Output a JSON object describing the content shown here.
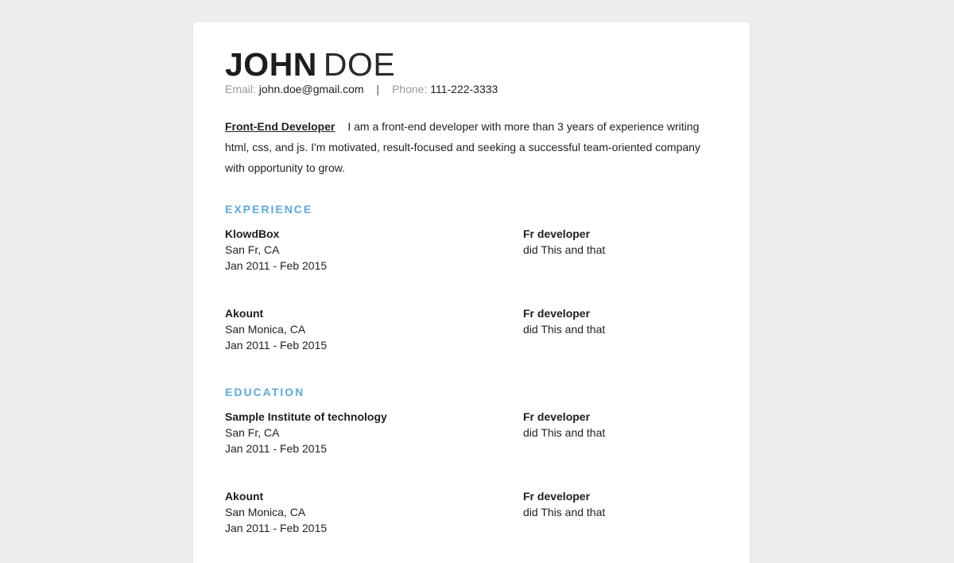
{
  "header": {
    "first_name": "JOHN",
    "last_name": "DOE",
    "email_label": "Email:",
    "email": "john.doe@gmail.com",
    "separator": "|",
    "phone_label": "Phone:",
    "phone": "111-222-3333"
  },
  "summary": {
    "role": "Front-End Developer",
    "text": "I am a front-end developer with more than 3 years of experience writing html, css, and js. I'm motivated, result-focused and seeking a successful team-oriented company with opportunity to grow."
  },
  "experience": {
    "title": "EXPERIENCE",
    "entries": [
      {
        "org": "KlowdBox",
        "location": "San Fr, CA",
        "dates": "Jan 2011 - Feb 2015",
        "role": "Fr developer",
        "desc": "did This and that"
      },
      {
        "org": "Akount",
        "location": "San Monica, CA",
        "dates": "Jan 2011 - Feb 2015",
        "role": "Fr developer",
        "desc": "did This and that"
      }
    ]
  },
  "education": {
    "title": "EDUCATION",
    "entries": [
      {
        "org": "Sample Institute of technology",
        "location": "San Fr, CA",
        "dates": "Jan 2011 - Feb 2015",
        "role": "Fr developer",
        "desc": "did This and that"
      },
      {
        "org": "Akount",
        "location": "San Monica, CA",
        "dates": "Jan 2011 - Feb 2015",
        "role": "Fr developer",
        "desc": "did This and that"
      }
    ]
  },
  "colors": {
    "accent": "#5aaadc",
    "background": "#ededed",
    "page": "#ffffff"
  }
}
